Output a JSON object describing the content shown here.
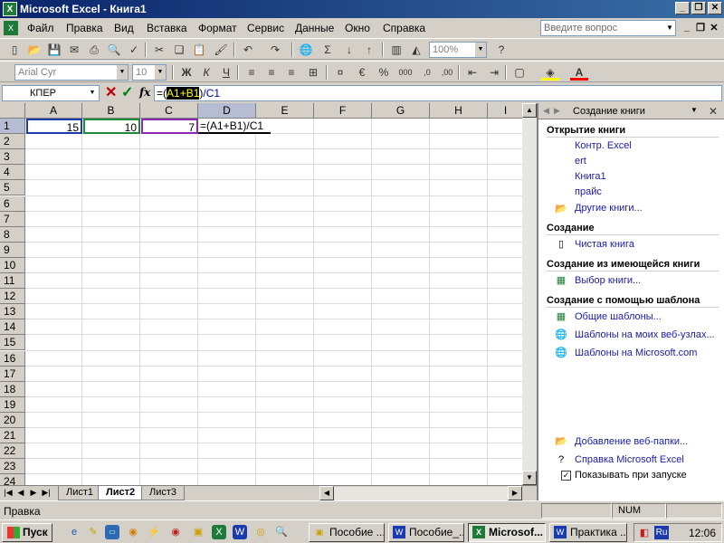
{
  "window": {
    "title": "Microsoft Excel - Книга1",
    "app_icon": "excel-icon"
  },
  "menu": {
    "items": [
      "Файл",
      "Правка",
      "Вид",
      "Вставка",
      "Формат",
      "Сервис",
      "Данные",
      "Окно",
      "Справка"
    ],
    "help_placeholder": "Введите вопрос"
  },
  "toolbar": {
    "zoom": "100%"
  },
  "format_toolbar": {
    "font": "Arial Cyr",
    "size": "10",
    "bold": "Ж",
    "italic": "К",
    "underline": "Ч"
  },
  "formula_bar": {
    "name_box": "КПЕР",
    "fx": "fx",
    "formula_pre": "=(",
    "formula_ref": "A1+B1",
    "formula_mid": ")",
    "formula_post": "/C1"
  },
  "sheet": {
    "columns": [
      "A",
      "B",
      "C",
      "D",
      "E",
      "F",
      "G",
      "H",
      "I"
    ],
    "rows": [
      "1",
      "2",
      "3",
      "4",
      "5",
      "6",
      "7",
      "8",
      "9",
      "10",
      "11",
      "12",
      "13",
      "14",
      "15",
      "16",
      "17",
      "18",
      "19",
      "20",
      "21",
      "22",
      "23",
      "24"
    ],
    "cells": {
      "A1": "15",
      "B1": "10",
      "C1": "7",
      "D1": "=(A1+B1)/C1"
    }
  },
  "sheet_tabs": [
    "Лист1",
    "Лист2",
    "Лист3"
  ],
  "active_tab": "Лист2",
  "task_pane": {
    "title": "Создание книги",
    "open_section": "Открытие книги",
    "open_items": [
      "Контр. Excel",
      "ert",
      "Книга1",
      "прайс"
    ],
    "more_books": "Другие книги...",
    "create_section": "Создание",
    "blank_book": "Чистая книга",
    "from_existing_section": "Создание из имеющейся книги",
    "choose_book": "Выбор книги...",
    "template_section": "Создание с помощью шаблона",
    "general_templates": "Общие шаблоны...",
    "web_templates": "Шаблоны на моих веб-узлах...",
    "ms_templates": "Шаблоны на Microsoft.com",
    "add_web_folder": "Добавление веб-папки...",
    "excel_help": "Справка Microsoft Excel",
    "show_on_startup": "Показывать при запуске"
  },
  "status": {
    "text": "Правка",
    "num": "NUM"
  },
  "taskbar": {
    "start": "Пуск",
    "tasks": [
      "Пособие ...",
      "Пособие_...",
      "Microsof...",
      "Практика ..."
    ],
    "lang": "Ru",
    "clock": "12:06"
  },
  "colors": {
    "title_gradient_start": "#0a246a",
    "title_gradient_end": "#3a6ea5",
    "link": "#1a1aa6"
  }
}
